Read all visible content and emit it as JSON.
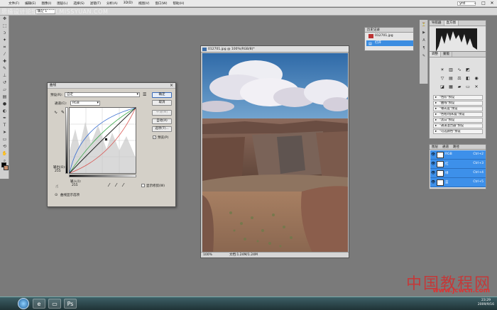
{
  "menubar": {
    "items": [
      "文件(F)",
      "编辑(E)",
      "图像(I)",
      "图层(L)",
      "选择(S)",
      "滤镜(T)",
      "分析(A)",
      "3D(D)",
      "视图(V)",
      "窗口(W)",
      "帮助(H)"
    ],
    "user": "yrd"
  },
  "watermark": "思缘设计论坛  WWW.MISSYUAN.COM",
  "options": {
    "field": "确定 1"
  },
  "document": {
    "title": "012701.jpg @ 100%(RGB/8)*",
    "zoom": "100%",
    "doc_size": "文档:1.24M/1.24M"
  },
  "curves": {
    "title": "曲线",
    "preset_label": "预设(R):",
    "preset_value": "自定",
    "channel_label": "通道(C):",
    "channel_value": "RGB",
    "output_label": "输出(O):",
    "output_value": "255",
    "input_label": "输入(I):",
    "input_value": "255",
    "show_clipping": "显示修剪(W)",
    "curve_display": "曲线显示选项",
    "buttons": {
      "ok": "确定",
      "cancel": "取消",
      "smooth": "平滑(M)",
      "auto": "自动(A)",
      "options": "选项(T)...",
      "preview": "预览(P)"
    }
  },
  "history": {
    "title": "历史记录",
    "snapshot": "012701.jpg",
    "step": "打开"
  },
  "navigator": {
    "tabs": [
      "导航器",
      "直方图"
    ]
  },
  "adjustments": {
    "tabs": [
      "调整",
      "蒙版"
    ],
    "presets": [
      "\"色阶\"预设",
      "\"曲线\"预设",
      "\"曝光度\"预设",
      "\"色相/饱和度\"预设",
      "\"黑白\"预设",
      "\"通道混合器\"预设",
      "\"可选颜色\"预设"
    ]
  },
  "layers": {
    "tabs": [
      "图层",
      "通道",
      "路径"
    ],
    "items": [
      {
        "name": "RGB",
        "shortcut": "Ctrl+2"
      },
      {
        "name": "红",
        "shortcut": "Ctrl+3"
      },
      {
        "name": "绿",
        "shortcut": "Ctrl+4"
      },
      {
        "name": "蓝",
        "shortcut": "Ctrl+5"
      }
    ]
  },
  "taskbar": {
    "time": "23:29",
    "date": "2009/9/16"
  },
  "brand": {
    "name": "中国教程网",
    "url": "www.jcwcn.com"
  },
  "colors": {
    "selection": "#3d90ea",
    "curve_rgb": "#000000",
    "curve_red": "#d9534f",
    "curve_green": "#3aa64a",
    "curve_blue": "#3b6fd1"
  }
}
